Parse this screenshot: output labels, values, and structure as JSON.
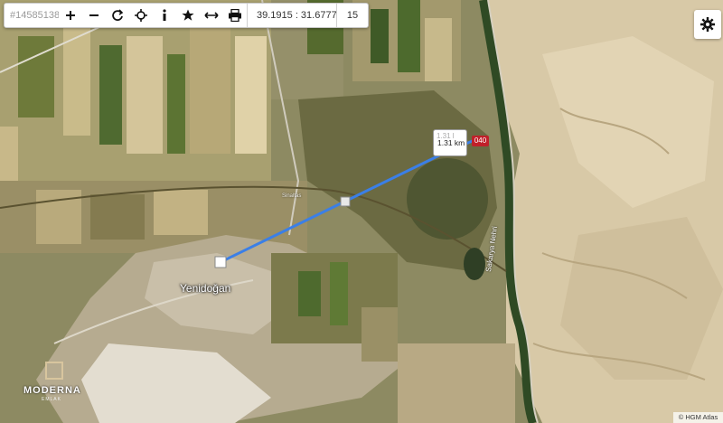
{
  "toolbar": {
    "id_text": "#14585138",
    "zoom_in_icon": "plus-icon",
    "zoom_out_icon": "minus-icon",
    "refresh_icon": "refresh-icon",
    "locate_icon": "crosshair-icon",
    "info_icon": "info-icon",
    "favorite_icon": "star-icon",
    "measure_icon": "arrows-horizontal-icon",
    "print_icon": "printer-icon",
    "coordinates": "39.1915 : 31.6777",
    "zoom_level": "15"
  },
  "settings": {
    "icon": "gear-icon"
  },
  "measurement": {
    "faded_label": "1.31 l",
    "distance": "1.31 km",
    "end_badge": "040",
    "line_color": "#3b7fe6"
  },
  "labels": {
    "town": "Yenidoğan",
    "road_vertical": "Sakarya Nehri",
    "road_small": "Sinaltas"
  },
  "logo": {
    "name": "MODERNA",
    "tagline": "EMLAK"
  },
  "attribution": "© HGM Atlas"
}
